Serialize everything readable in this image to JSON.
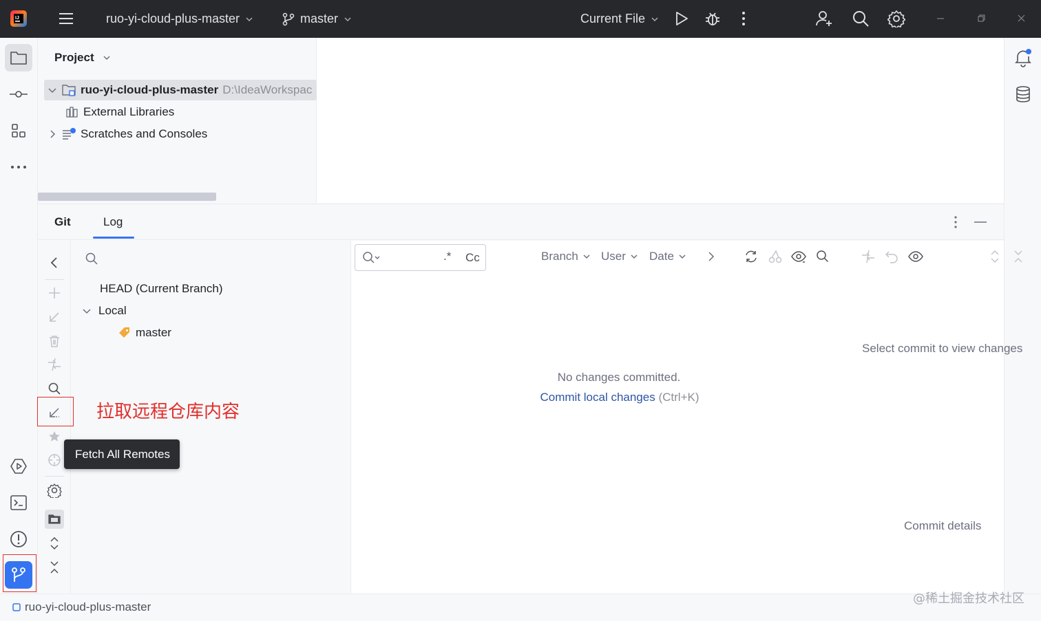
{
  "titlebar": {
    "project_name": "ruo-yi-cloud-plus-master",
    "branch": "master",
    "run_config": "Current File"
  },
  "project_panel": {
    "title": "Project",
    "tree": [
      {
        "label": "ruo-yi-cloud-plus-master",
        "path": "D:\\IdeaWorkspac"
      },
      {
        "label": "External Libraries"
      },
      {
        "label": "Scratches and Consoles"
      }
    ]
  },
  "git": {
    "tabs": [
      "Git",
      "Log"
    ],
    "branches": {
      "head": "HEAD (Current Branch)",
      "local": "Local",
      "master": "master"
    },
    "log": {
      "regex_label": ".*",
      "case_label": "Cc",
      "filters": [
        "Branch",
        "User",
        "Date"
      ],
      "empty_text": "No changes committed.",
      "commit_link": "Commit local changes",
      "commit_shortcut": "(Ctrl+K)",
      "select_commit": "Select commit to view changes",
      "commit_details": "Commit details"
    },
    "tooltip": "Fetch All Remotes"
  },
  "annotation": "拉取远程仓库内容",
  "status_bar": {
    "project": "ruo-yi-cloud-plus-master"
  },
  "watermark": "@稀土掘金技术社区",
  "colors": {
    "accent": "#3574f0",
    "annotation_red": "#e0302b",
    "titlebar": "#27282c"
  }
}
